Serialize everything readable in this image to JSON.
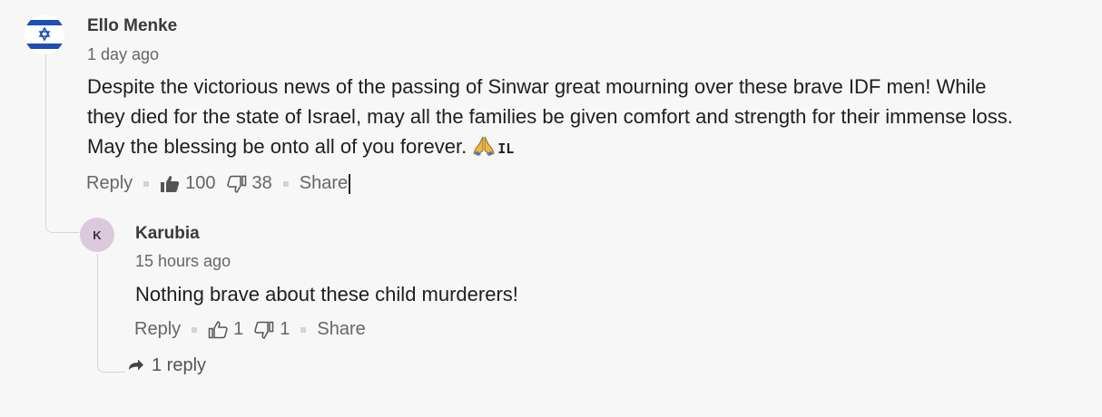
{
  "comment": {
    "author": "Ello Menke",
    "time": "1 day ago",
    "body_line1": "Despite the victorious news of the passing of Sinwar great mourning over these brave IDF men! While",
    "body_line2": "they died for the state of Israel, may all the families be given comfort and strength for their immense loss.",
    "body_line3": "May the blessing be onto all of you forever.",
    "badge": "IL",
    "actions": {
      "reply": "Reply",
      "likes": "100",
      "dislikes": "38",
      "share": "Share"
    }
  },
  "reply": {
    "avatar_letter": "K",
    "author": "Karubia",
    "time": "15 hours ago",
    "body": "Nothing brave about these child murderers!",
    "actions": {
      "reply": "Reply",
      "likes": "1",
      "dislikes": "1",
      "share": "Share"
    },
    "replies_link": "1 reply"
  },
  "icons": {
    "avatar": "israel-flag-icon",
    "emoji": "folded-hands-icon",
    "like_filled": "thumbs-up-filled-icon",
    "like_outline": "thumbs-up-outline-icon",
    "dislike": "thumbs-down-outline-icon",
    "reply_arrow": "reply-arrow-icon"
  },
  "colors": {
    "background": "#f7f7f7",
    "flag_blue": "#1f4fb4",
    "avatar_k_bg": "#ddc9de",
    "action_text": "#666666"
  }
}
